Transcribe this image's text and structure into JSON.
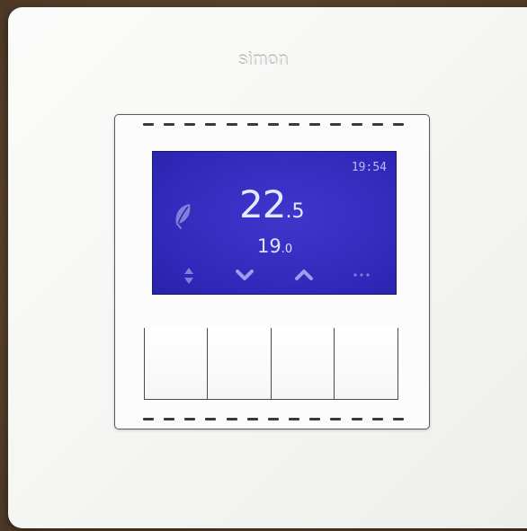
{
  "device": {
    "brand": "simon"
  },
  "display": {
    "time": "19:54",
    "current_temp": {
      "whole": "22",
      "decimal": ".5"
    },
    "set_temp": {
      "whole": "19",
      "decimal": ".0"
    },
    "mode_icon": "leaf-icon",
    "soft_keys": [
      {
        "icon": "up-down-arrows-icon",
        "action": "mode"
      },
      {
        "icon": "chevron-down-icon",
        "action": "decrease"
      },
      {
        "icon": "chevron-up-icon",
        "action": "increase"
      },
      {
        "icon": "ellipsis-icon",
        "action": "menu"
      }
    ]
  },
  "colors": {
    "lcd_background": "#3128bb",
    "lcd_text": "#e6e8ff",
    "lcd_icons": "#7d82d8",
    "plate": "#f4f4f2",
    "wall": "#5a4330"
  }
}
